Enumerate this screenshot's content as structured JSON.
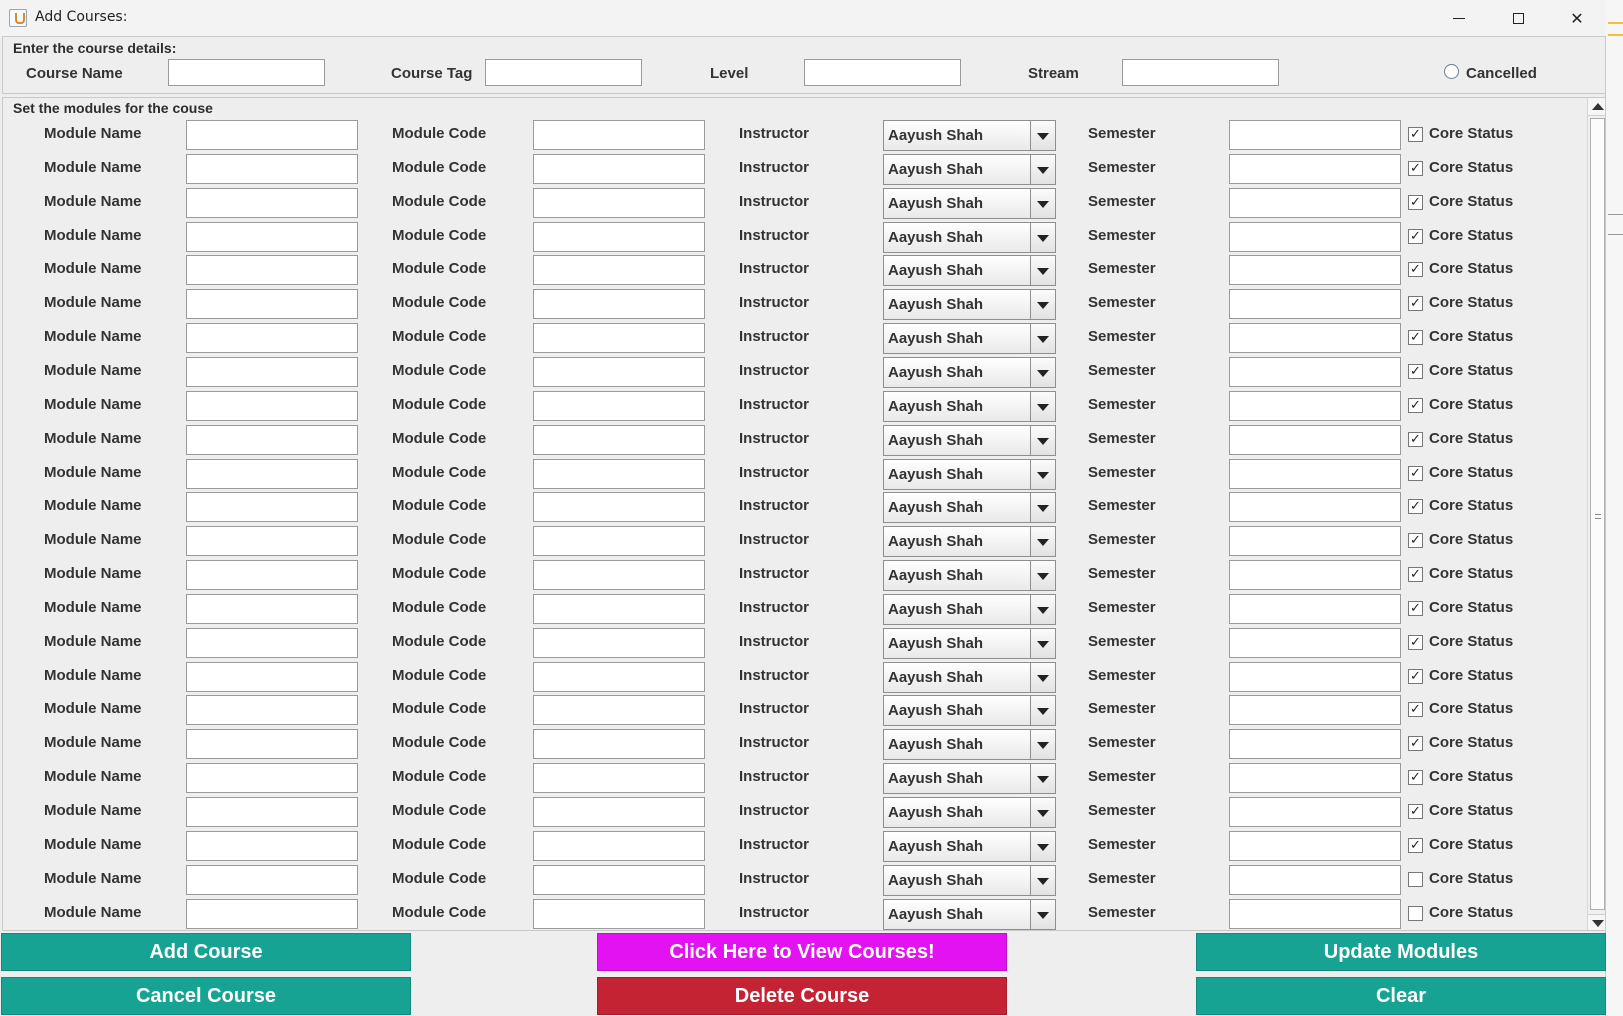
{
  "window": {
    "title": "Add Courses:"
  },
  "course_details": {
    "legend": "Enter the course details:",
    "course_name_label": "Course Name",
    "course_name_value": "",
    "course_tag_label": "Course Tag",
    "course_tag_value": "",
    "level_label": "Level",
    "level_value": "",
    "stream_label": "Stream",
    "stream_value": "",
    "cancelled_label": "Cancelled",
    "cancelled_selected": false
  },
  "modules": {
    "legend": "Set the modules for the couse",
    "module_name_label": "Module Name",
    "module_code_label": "Module Code",
    "instructor_label": "Instructor",
    "semester_label": "Semester",
    "core_status_label": "Core Status",
    "rows": [
      {
        "instructor": "Aayush Shah",
        "core": true
      },
      {
        "instructor": "Aayush Shah",
        "core": true
      },
      {
        "instructor": "Aayush Shah",
        "core": true
      },
      {
        "instructor": "Aayush Shah",
        "core": true
      },
      {
        "instructor": "Aayush Shah",
        "core": true
      },
      {
        "instructor": "Aayush Shah",
        "core": true
      },
      {
        "instructor": "Aayush Shah",
        "core": true
      },
      {
        "instructor": "Aayush Shah",
        "core": true
      },
      {
        "instructor": "Aayush Shah",
        "core": true
      },
      {
        "instructor": "Aayush Shah",
        "core": true
      },
      {
        "instructor": "Aayush Shah",
        "core": true
      },
      {
        "instructor": "Aayush Shah",
        "core": true
      },
      {
        "instructor": "Aayush Shah",
        "core": true
      },
      {
        "instructor": "Aayush Shah",
        "core": true
      },
      {
        "instructor": "Aayush Shah",
        "core": true
      },
      {
        "instructor": "Aayush Shah",
        "core": true
      },
      {
        "instructor": "Aayush Shah",
        "core": true
      },
      {
        "instructor": "Aayush Shah",
        "core": true
      },
      {
        "instructor": "Aayush Shah",
        "core": true
      },
      {
        "instructor": "Aayush Shah",
        "core": true
      },
      {
        "instructor": "Aayush Shah",
        "core": true
      },
      {
        "instructor": "Aayush Shah",
        "core": true
      },
      {
        "instructor": "Aayush Shah",
        "core": false
      },
      {
        "instructor": "Aayush Shah",
        "core": false
      }
    ]
  },
  "buttons": {
    "add_course": "Add Course",
    "view_courses": "Click Here to View Courses!",
    "update_modules": "Update Modules",
    "cancel_course": "Cancel Course",
    "delete_course": "Delete Course",
    "clear": "Clear"
  },
  "colors": {
    "teal": "#17a393",
    "magenta": "#e312f0",
    "red": "#c42333"
  }
}
